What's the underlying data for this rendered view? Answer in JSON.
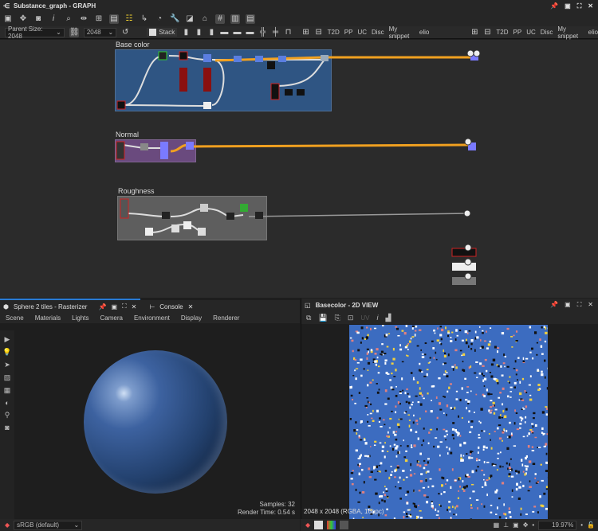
{
  "graph_window": {
    "title": "Substance_graph - GRAPH",
    "parent_size_label": "Parent Size:",
    "parent_size": "2048",
    "size_value": "2048",
    "stack_label": "Stack",
    "snippets_left": [
      "T2D",
      "PP",
      "UC",
      "Disc",
      "My snippet",
      "elio"
    ],
    "snippets_right": [
      "T2D",
      "PP",
      "UC",
      "Disc",
      "My snippet",
      "elio"
    ],
    "frames": [
      {
        "label": "Base color",
        "color": "#2f5583"
      },
      {
        "label": "Normal",
        "color": "#6a4a7e"
      },
      {
        "label": "Roughness",
        "color": "#5e5e5e"
      }
    ]
  },
  "viewport3d": {
    "tab_title": "Sphere 2 tiles - Rasterizer",
    "console_tab": "Console",
    "menu": [
      "Scene",
      "Materials",
      "Lights",
      "Camera",
      "Environment",
      "Display",
      "Renderer"
    ],
    "samples": "Samples: 32",
    "render_time": "Render Time: 0.54 s",
    "colorspace": "sRGB (default)"
  },
  "view2d": {
    "title": "Basecolor - 2D VIEW",
    "uv_label": "UV",
    "image_info": "2048 x 2048 (RGBA, 16bpc)",
    "zoom": "19.97%"
  },
  "colors": {
    "accent": "#2a7bd4",
    "wire": "#f0a020"
  }
}
